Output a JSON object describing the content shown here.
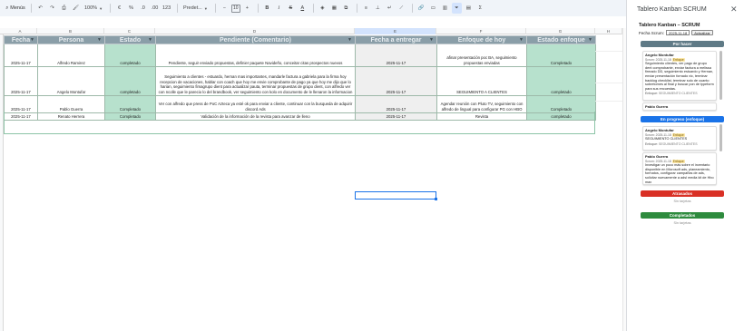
{
  "toolbar": {
    "menus_label": "Menús",
    "zoom": "100%",
    "currency": "€",
    "percent": "%",
    "dec_decrease": ".0",
    "dec_increase": ".00",
    "number_format": "123",
    "font": "Predet...",
    "font_size": "10",
    "bold": "B",
    "italic": "I",
    "strike": "S",
    "text_color": "A",
    "sum": "Σ"
  },
  "columns": [
    "A",
    "B",
    "C",
    "D",
    "E",
    "F",
    "G",
    "H"
  ],
  "selected_column": "E",
  "table": {
    "headers": [
      "Fecha",
      "Persona",
      "Estado",
      "Pendiente (Comentario)",
      "Fecha a entregar",
      "Enfoque de hoy",
      "Estado enfoque"
    ],
    "rows": [
      [
        "2025-11-17",
        "Alfredo Ramirez",
        "completado",
        "Pendiente, seguir enviado propuestas, definier paquete Navideño, conceitar citas prospectos nuevos",
        "2025-11-17",
        "afinar presentación poc BA, seguimiento propuestas enviadas",
        "Completado"
      ],
      [
        "2025-11-17",
        "Angelo Montufar",
        "completado",
        "Seguimiento a clientes - estuardo, hernan mas importantes, mandarle factura a gabriela para la firma hoy recepcion de vacaciones, hablar con coach que hoy me envie comprobante de pago ya que hoy me dijo que lo harian, seguimiento fimagrupo dient para actualizar pauta, terminar propuestas de grupo dient, con alfredo ver con ncolle que le parecio lo del brandbook, ver seguimiento con kolo en documento de le llenaron la informacion",
        "2025-11-17",
        "SEGUIMIENTO A CLIENTES",
        "completado"
      ],
      [
        "2025-11-17",
        "Pablo Guerra",
        "Completado",
        "Ver con alfredo que press de PoC Azteca ya esté ok para enviar a cliente, continuar con la busqueda de adquirir discord Ads",
        "2025-11-17",
        "Agendar reunión con Pluto TV, seguimiento con alfredo de lingual para configurar PG con HBO",
        "Completado"
      ],
      [
        "2025-11-17",
        "Renato Herrera",
        "Completado",
        "Validación de la información de la revista para avanzar de lleno",
        "2025-11-17",
        "Revista",
        "completado"
      ]
    ]
  },
  "panel": {
    "title": "Tablero Kanban SCRUM",
    "close": "✕",
    "inner_title": "Tablero Kanban – SCRUM",
    "sprint_label": "Fecha Scrum:",
    "sprint_value": "2025-11-18",
    "refresh_label": "Actualizar",
    "columns": [
      {
        "name": "Por hacer",
        "color": "#5f7a86",
        "cards": [
          {
            "who": "Angelo Montufar",
            "meta": "Scrum: 2025-11-18",
            "badge": "Enfoque",
            "text": "Seguimiento clientes, ver pago de grupo dent comprobante, enviar factura a melissa firmado DD, seguimiento estuardo y Hernan, enviar presentación fornado vic, terminar backlog checklist, terminar solo de cuanto sobretomes al final y buscar pon de typeform para sus encuestas.",
            "focus_label": "Enfoque:",
            "focus": "SEGUIMIENTO CLIENTES"
          },
          {
            "who": "Pablo Guerra",
            "meta": "",
            "badge": "",
            "text": "",
            "focus_label": "",
            "focus": ""
          }
        ],
        "empty": ""
      },
      {
        "name": "En progreso (enfoque)",
        "color": "#1a73e8",
        "cards": [
          {
            "who": "Angelo Montufar",
            "meta": "Scrum: 2025-11-18",
            "badge": "Enfoque",
            "text": "SEGUIMIENTO CLIENTES",
            "focus_label": "Enfoque:",
            "focus": "SEGUIMIENTO CLIENTES"
          },
          {
            "who": "Pablo Guerra",
            "meta": "Scrum: 2025-11-18",
            "badge": "Enfoque",
            "text": "Investigar un poco más sobre el inventario disponible en Microsoft ads, planeamiento, formatos, configurar campañas de ads, solicitar nuevamente a adsl media kit de Hbo max",
            "focus_label": "",
            "focus": ""
          }
        ],
        "empty": ""
      },
      {
        "name": "Atrasados",
        "color": "#d93025",
        "cards": [],
        "empty": "Sin tarjetas"
      },
      {
        "name": "Completados",
        "color": "#2e8b3e",
        "cards": [],
        "empty": "Sin tarjetas"
      }
    ]
  }
}
